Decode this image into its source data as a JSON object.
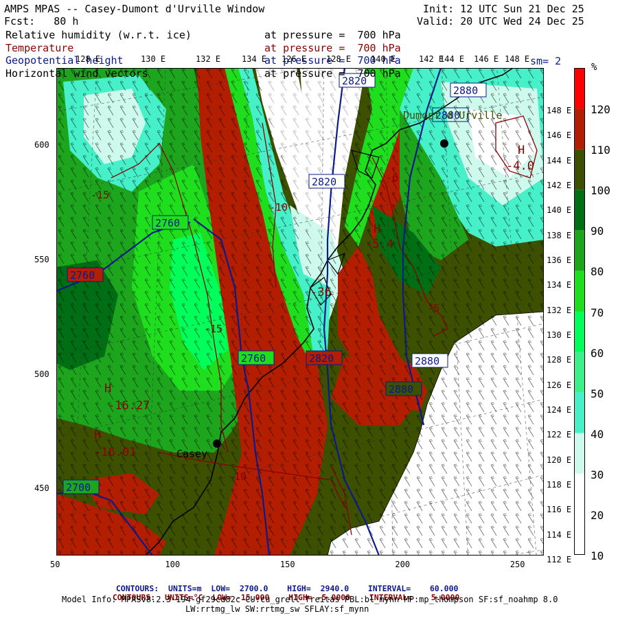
{
  "header": {
    "title": "AMPS MPAS -- Casey-Dumont d'Urville Window",
    "init": "Init: 12 UTC Sun 21 Dec 25",
    "forecast": "Fcst:   80 h",
    "valid": "Valid: 20 UTC Wed 24 Dec 25",
    "fields": [
      {
        "name": "Relative humidity (w.r.t. ice)",
        "level": "at pressure =  700 hPa",
        "color": "#000000"
      },
      {
        "name": "Temperature",
        "level": "at pressure =  700 hPa",
        "color": "#8b0000"
      },
      {
        "name": "Geopotential height",
        "level": "at pressure =  700 hPa",
        "color": "#0a1a8a"
      },
      {
        "name": "Horizontal wind vectors",
        "level": "at pressure =  700 hPa",
        "color": "#000000"
      }
    ],
    "sm": "sm= 2"
  },
  "top_lon_labels": [
    "128 E",
    "130 E",
    "132 E",
    "134 E",
    "126 E",
    "128 E",
    "140 E",
    "142 E",
    "144 E",
    "146 E",
    "148 E"
  ],
  "right_lat_labels": [
    "148 E",
    "146 E",
    "144 E",
    "142 E",
    "140 E",
    "138 E",
    "136 E",
    "134 E",
    "132 E",
    "130 E",
    "128 E",
    "126 E",
    "124 E",
    "122 E",
    "120 E",
    "118 E",
    "116 E",
    "114 E",
    "112 E"
  ],
  "x_axis": {
    "ticks": [
      "50",
      "100",
      "150",
      "200",
      "250"
    ],
    "values": [
      50,
      100,
      150,
      200,
      250
    ],
    "range": [
      50,
      262
    ]
  },
  "y_axis": {
    "ticks": [
      "600",
      "550",
      "500",
      "450"
    ],
    "values": [
      600,
      550,
      500,
      450
    ],
    "range": [
      421,
      634
    ]
  },
  "colorbar": {
    "unit": "%",
    "labels": [
      "120",
      "110",
      "100",
      "90",
      "80",
      "70",
      "60",
      "50",
      "40",
      "30",
      "20",
      "10"
    ],
    "bands": [
      {
        "from": 120,
        "color": "#ff0000"
      },
      {
        "from": 110,
        "color": "#b41e00"
      },
      {
        "from": 100,
        "color": "#3c5000"
      },
      {
        "from": 90,
        "color": "#006e14"
      },
      {
        "from": 80,
        "color": "#1ea51e"
      },
      {
        "from": 70,
        "color": "#1ede1e"
      },
      {
        "from": 60,
        "color": "#00ff5a"
      },
      {
        "from": 50,
        "color": "#3cf08c"
      },
      {
        "from": 40,
        "color": "#46f0c8"
      },
      {
        "from": 30,
        "color": "#cdfaec"
      },
      {
        "from": 20,
        "color": "#ffffff"
      },
      {
        "from": 10,
        "color": "#ffffff"
      }
    ]
  },
  "map_labels": {
    "height_contours": [
      "2820",
      "2880",
      "2880",
      "2820",
      "2760",
      "2760",
      "2760",
      "2820",
      "2880",
      "2880",
      "2700"
    ],
    "temp_contours": [
      "-15",
      "-10",
      "-15",
      "-10",
      "-6",
      "-5"
    ],
    "extrema": [
      "H",
      "H",
      "H",
      "H"
    ],
    "extrema_values": [
      "-4.0",
      "-5.4",
      "-16.27",
      "-16.01",
      "-36"
    ],
    "stations": [
      "Casey",
      "Dumont d'Urville"
    ]
  },
  "footer": {
    "line1": {
      "label": "CONTOURS:",
      "units": "UNITS=m",
      "low": "LOW=  2700.0",
      "high": "HIGH=  2940.0",
      "interval": "INTERVAL=    60.000"
    },
    "line2": {
      "label": "CONTOURS:",
      "units": "UNITS=°C",
      "low": "LOW= -15.000",
      "high": "HIGH= -5.0000",
      "interval": "INTERVAL=    5.0000"
    },
    "model_info": "Model Info: MPASv8.2.3-194-gf29cd82c CU:cu_grell_freitas PBL:bl_mynn MP:mp_thompson SF:sf_noahmp 8.0",
    "model_info2": "LW:rrtmg_lw SW:rrtmg_sw SFLAY:sf_mynn"
  }
}
